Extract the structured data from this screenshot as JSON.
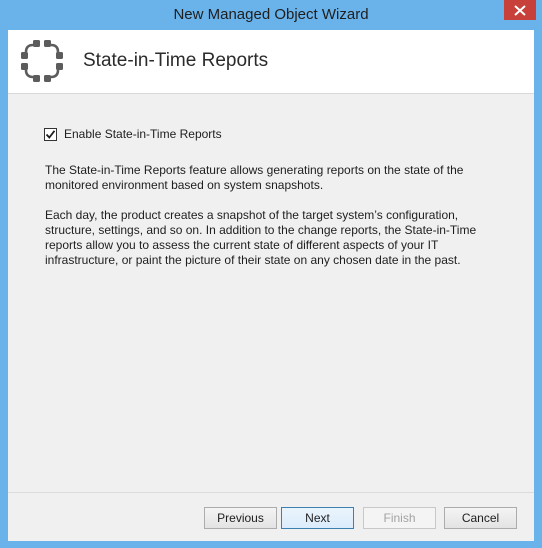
{
  "window": {
    "title": "New Managed Object Wizard"
  },
  "header": {
    "title": "State-in-Time Reports",
    "icon": "state-in-time-icon"
  },
  "options": {
    "enable_label": "Enable State-in-Time Reports",
    "enable_checked": true
  },
  "description": {
    "paragraph1": "The State-in-Time Reports feature allows generating reports on the state of the monitored environment based on system snapshots.",
    "paragraph2": "Each day, the product creates a snapshot of the target system’s configuration, structure, settings, and so on. In addition to the change reports, the State-in-Time reports allow you to assess the current state of different aspects of your IT infrastructure, or paint the picture of their state on any chosen date in the past."
  },
  "buttons": {
    "previous": "Previous",
    "next": "Next",
    "finish": "Finish",
    "cancel": "Cancel"
  },
  "colors": {
    "titlebar": "#6ab3ea",
    "close": "#c7403a",
    "icon": "#5c5c5c"
  }
}
